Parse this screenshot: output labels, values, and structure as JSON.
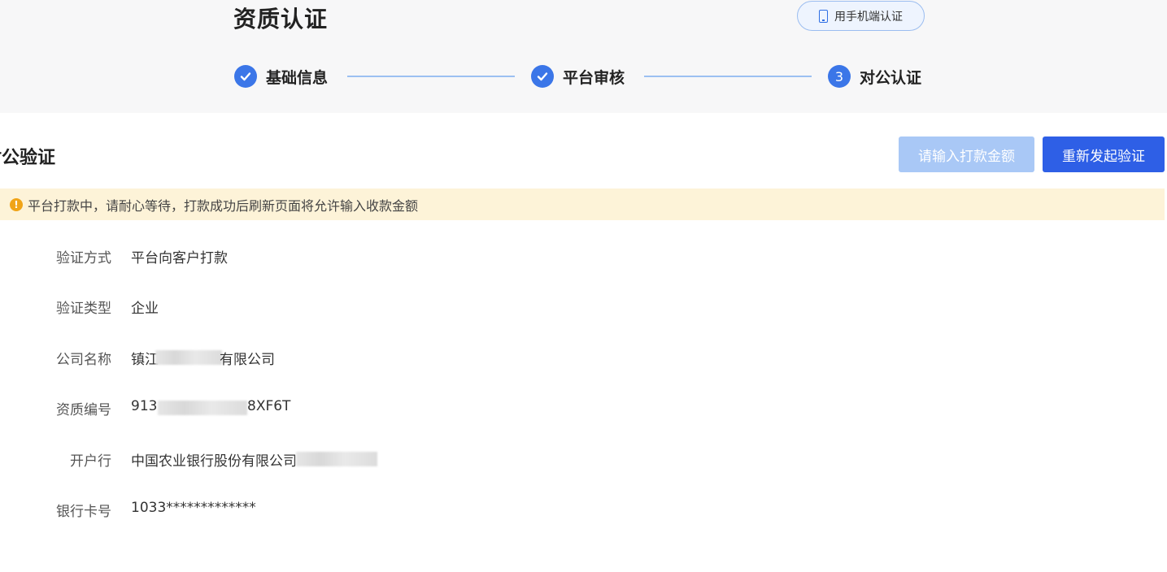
{
  "header": {
    "title": "资质认证",
    "mobile_button_label": "用手机端认证"
  },
  "steps": [
    {
      "label": "基础信息",
      "state": "done"
    },
    {
      "label": "平台审核",
      "state": "done"
    },
    {
      "label": "对公认证",
      "state": "current",
      "number": "3"
    }
  ],
  "section": {
    "title": "对公验证",
    "amount_button_label": "请输入打款金额",
    "restart_button_label": "重新发起验证"
  },
  "notice": {
    "text": "平台打款中，请耐心等待，打款成功后刷新页面将允许输入收款金额"
  },
  "details": [
    {
      "label": "验证方式",
      "value": "平台向客户打款"
    },
    {
      "label": "验证类型",
      "value": "企业"
    },
    {
      "label": "公司名称",
      "value_prefix": "镇江",
      "value_suffix": "有限公司"
    },
    {
      "label": "资质编号",
      "value_prefix": "913",
      "value_suffix": "8XF6T"
    },
    {
      "label": "开户行",
      "value": "中国农业银行股份有限公司"
    },
    {
      "label": "银行卡号",
      "value": "1033*************"
    }
  ],
  "colors": {
    "primary": "#2e5fe6",
    "step_blue": "#3b76e8",
    "disabled_button": "#a9c8f6",
    "notice_bg": "#fdf3d8",
    "warning": "#f0a418"
  }
}
